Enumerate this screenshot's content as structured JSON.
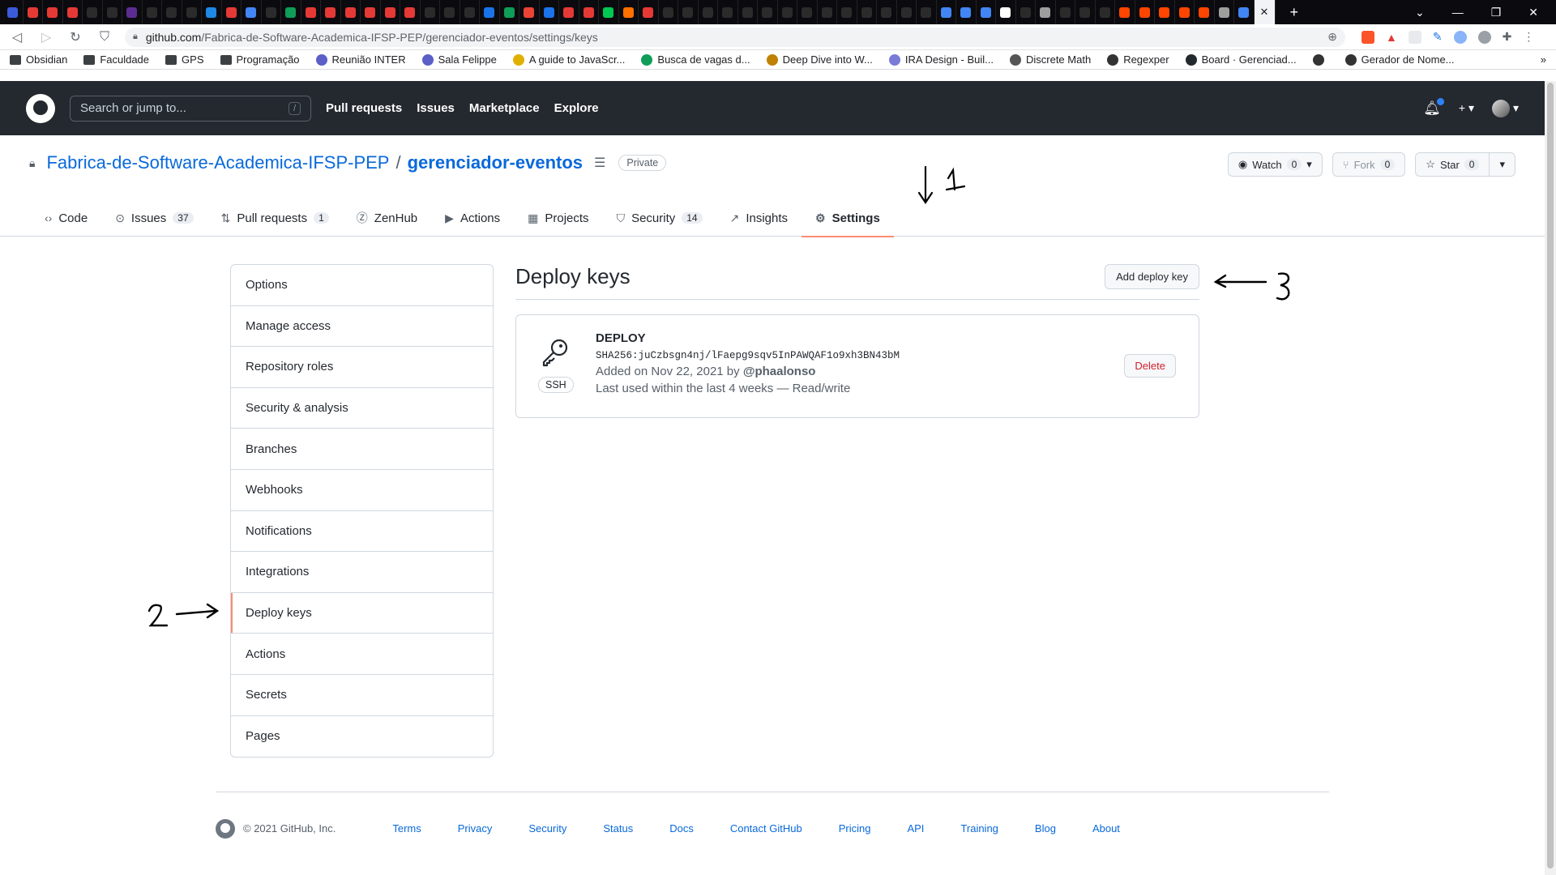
{
  "browser": {
    "tab_colors": [
      "#3b5bdb",
      "#e53935",
      "#e53935",
      "#e53935",
      "#2b2b2b",
      "#2b2b2b",
      "#5c2d91",
      "#2b2b2b",
      "#2b2b2b",
      "#2b2b2b",
      "#1e88e5",
      "#e53935",
      "#4285f4",
      "#2b2b2b",
      "#0f9d58",
      "#e53935",
      "#e53935",
      "#e53935",
      "#e53935",
      "#e53935",
      "#e53935",
      "#2b2b2b",
      "#2b2b2b",
      "#2b2b2b",
      "#1a73e8",
      "#0f9d58",
      "#ea4335",
      "#1a73e8",
      "#e53935",
      "#e53935",
      "#00c853",
      "#ff6f00",
      "#e53935",
      "#2b2b2b",
      "#2b2b2b",
      "#2b2b2b",
      "#2b2b2b",
      "#2b2b2b",
      "#2b2b2b",
      "#2b2b2b",
      "#2b2b2b",
      "#2b2b2b",
      "#2b2b2b",
      "#2b2b2b",
      "#2b2b2b",
      "#2b2b2b",
      "#2b2b2b",
      "#4285f4",
      "#4285f4",
      "#4285f4",
      "#ffffff",
      "#2b2b2b",
      "#9e9e9e",
      "#2b2b2b",
      "#2b2b2b",
      "#2b2b2b",
      "#ff4500",
      "#ff4500",
      "#ff4500",
      "#ff4500",
      "#ff4500",
      "#9e9e9e",
      "#4285f4"
    ],
    "url_host": "github.com",
    "url_path": "/Fabrica-de-Software-Academica-IFSP-PEP/gerenciador-eventos/settings/keys",
    "bookmarks": [
      {
        "label": "Obsidian",
        "type": "folder"
      },
      {
        "label": "Faculdade",
        "type": "folder"
      },
      {
        "label": "GPS",
        "type": "folder"
      },
      {
        "label": "Programação",
        "type": "folder"
      },
      {
        "label": "Reunião INTER",
        "type": "site",
        "color": "#5b5fc7"
      },
      {
        "label": "Sala Felippe",
        "type": "site",
        "color": "#5b5fc7"
      },
      {
        "label": "A guide to JavaScr...",
        "type": "site",
        "color": "#e0b000"
      },
      {
        "label": "Busca de vagas d...",
        "type": "site",
        "color": "#0f9d58"
      },
      {
        "label": "Deep Dive into W...",
        "type": "site",
        "color": "#c08000"
      },
      {
        "label": "IRA Design - Buil...",
        "type": "site",
        "color": "#7a7ad8"
      },
      {
        "label": "Discrete Math",
        "type": "site",
        "color": "#555555"
      },
      {
        "label": "Regexper",
        "type": "site",
        "color": "#333333"
      },
      {
        "label": "Board · Gerenciad...",
        "type": "site",
        "color": "#24292f"
      },
      {
        "label": "",
        "type": "site",
        "color": "#333333"
      },
      {
        "label": "Gerador de Nome...",
        "type": "site",
        "color": "#333333"
      }
    ]
  },
  "header": {
    "search_placeholder": "Search or jump to...",
    "search_shortcut": "/",
    "nav": [
      "Pull requests",
      "Issues",
      "Marketplace",
      "Explore"
    ]
  },
  "repo": {
    "owner": "Fabrica-de-Software-Academica-IFSP-PEP",
    "separator": "/",
    "name": "gerenciador-eventos",
    "visibility": "Private",
    "watch_label": "Watch",
    "watch_count": "0",
    "fork_label": "Fork",
    "fork_count": "0",
    "star_label": "Star",
    "star_count": "0",
    "tabs": [
      {
        "label": "Code",
        "count": "",
        "icon": "code-icon"
      },
      {
        "label": "Issues",
        "count": "37",
        "icon": "issue-icon"
      },
      {
        "label": "Pull requests",
        "count": "1",
        "icon": "pull-request-icon"
      },
      {
        "label": "ZenHub",
        "count": "",
        "icon": "zenhub-icon"
      },
      {
        "label": "Actions",
        "count": "",
        "icon": "play-icon"
      },
      {
        "label": "Projects",
        "count": "",
        "icon": "project-icon"
      },
      {
        "label": "Security",
        "count": "14",
        "icon": "shield-icon"
      },
      {
        "label": "Insights",
        "count": "",
        "icon": "graph-icon"
      },
      {
        "label": "Settings",
        "count": "",
        "icon": "gear-icon"
      }
    ]
  },
  "settings_menu": [
    "Options",
    "Manage access",
    "Repository roles",
    "Security & analysis",
    "Branches",
    "Webhooks",
    "Notifications",
    "Integrations",
    "Deploy keys",
    "Actions",
    "Secrets",
    "Pages"
  ],
  "deploy_keys": {
    "title": "Deploy keys",
    "add_button": "Add deploy key",
    "key": {
      "name": "DEPLOY",
      "fingerprint": "SHA256:juCzbsgn4nj/lFaepg9sqv5InPAWQAF1o9xh3BN43bM",
      "type": "SSH",
      "added_prefix": "Added on Nov 22, 2021 by",
      "added_by": "@phaalonso",
      "last_used": "Last used within the last 4 weeks — Read/write",
      "delete_label": "Delete"
    }
  },
  "footer": {
    "copyright": "© 2021 GitHub, Inc.",
    "links": [
      "Terms",
      "Privacy",
      "Security",
      "Status",
      "Docs",
      "Contact GitHub",
      "Pricing",
      "API",
      "Training",
      "Blog",
      "About"
    ]
  }
}
